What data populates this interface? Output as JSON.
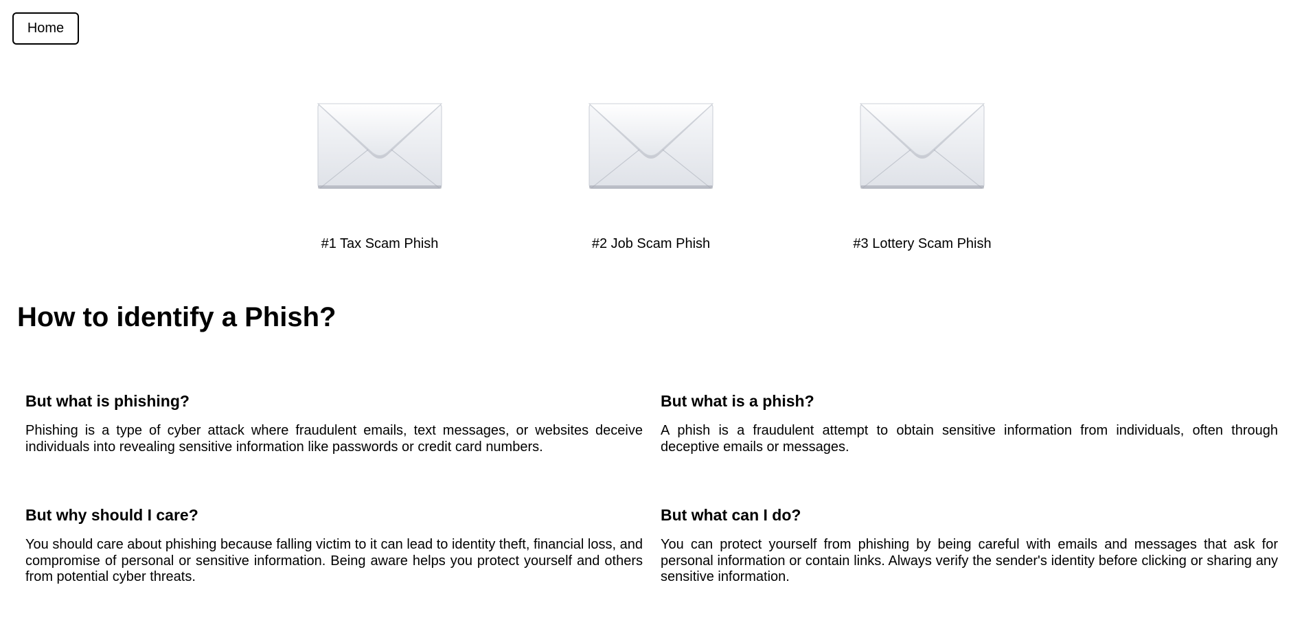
{
  "nav": {
    "home_label": "Home"
  },
  "cards": [
    {
      "label": "#1 Tax Scam Phish",
      "icon": "envelope-icon"
    },
    {
      "label": "#2 Job Scam Phish",
      "icon": "envelope-icon"
    },
    {
      "label": "#3 Lottery Scam Phish",
      "icon": "envelope-icon"
    }
  ],
  "main": {
    "title": "How to identify a Phish?"
  },
  "sections": [
    {
      "heading": "But what is phishing?",
      "body": "Phishing is a type of cyber attack where fraudulent emails, text messages, or websites deceive individuals into revealing sensitive information like passwords or credit card numbers."
    },
    {
      "heading": "But what is a phish?",
      "body": "A phish is a fraudulent attempt to obtain sensitive information from individuals, often through deceptive emails or messages."
    },
    {
      "heading": "But why should I care?",
      "body": "You should care about phishing because falling victim to it can lead to identity theft, financial loss, and compromise of personal or sensitive information. Being aware helps you protect yourself and others from potential cyber threats."
    },
    {
      "heading": "But what can I do?",
      "body": "You can protect yourself from phishing by being careful with emails and messages that ask for personal information or contain links. Always verify the sender's identity before clicking or sharing any sensitive information."
    }
  ],
  "colors": {
    "text": "#000000",
    "background": "#ffffff",
    "envelope_light": "#f4f6f9",
    "envelope_shadow": "#8d929c"
  }
}
